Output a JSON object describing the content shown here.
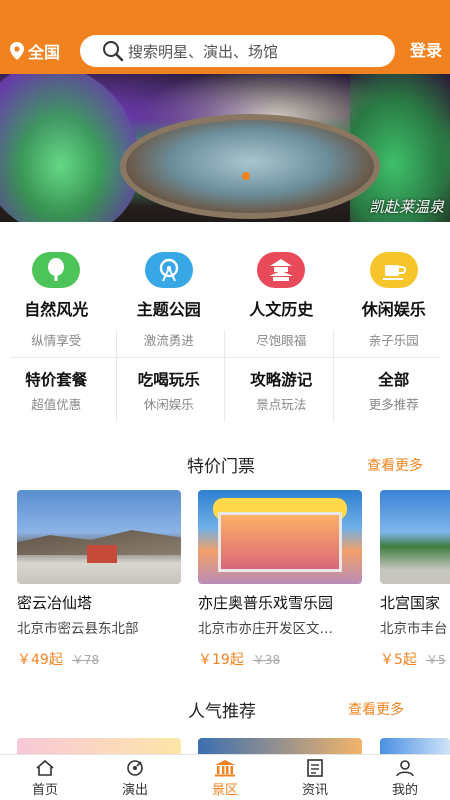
{
  "header": {
    "location": "全国",
    "search_placeholder": "搜索明星、演出、场馆",
    "login": "登录"
  },
  "banner": {
    "caption": "凯赴莱温泉"
  },
  "categories": [
    {
      "label": "自然风光",
      "subtitle": "纵情享受",
      "icon": "tree-icon",
      "color": "#4cc45a"
    },
    {
      "label": "主题公园",
      "subtitle": "激流勇进",
      "icon": "ferris-wheel-icon",
      "color": "#38a7e6"
    },
    {
      "label": "人文历史",
      "subtitle": "尽饱眼福",
      "icon": "pagoda-icon",
      "color": "#e94a5a"
    },
    {
      "label": "休闲娱乐",
      "subtitle": "亲子乐园",
      "icon": "coffee-cup-icon",
      "color": "#f5c52b"
    }
  ],
  "quick_links": [
    {
      "title": "特价套餐",
      "subtitle": "超值优惠"
    },
    {
      "title": "吃喝玩乐",
      "subtitle": "休闲娱乐"
    },
    {
      "title": "攻略游记",
      "subtitle": "景点玩法"
    },
    {
      "title": "全部",
      "subtitle": "更多推荐"
    }
  ],
  "tickets_section": {
    "title": "特价门票",
    "more": "查看更多",
    "items": [
      {
        "name": "密云冶仙塔",
        "address": "北京市密云县东北部",
        "price": "￥49起",
        "original": "￥78"
      },
      {
        "name": "亦庄奥普乐戏雪乐园",
        "address": "北京市亦庄开发区文…",
        "price": "￥19起",
        "original": "￥38"
      },
      {
        "name": "北宫国家",
        "address": "北京市丰台",
        "price": "￥5起",
        "original": "￥5"
      }
    ]
  },
  "popular_section": {
    "title": "人气推荐",
    "more": "查看更多"
  },
  "tabbar": [
    {
      "label": "首页",
      "icon": "home-icon",
      "active": false
    },
    {
      "label": "演出",
      "icon": "performance-icon",
      "active": false
    },
    {
      "label": "景区",
      "icon": "scenic-icon",
      "active": true
    },
    {
      "label": "资讯",
      "icon": "news-icon",
      "active": false
    },
    {
      "label": "我的",
      "icon": "profile-icon",
      "active": false
    }
  ],
  "colors": {
    "accent": "#f0831f"
  }
}
